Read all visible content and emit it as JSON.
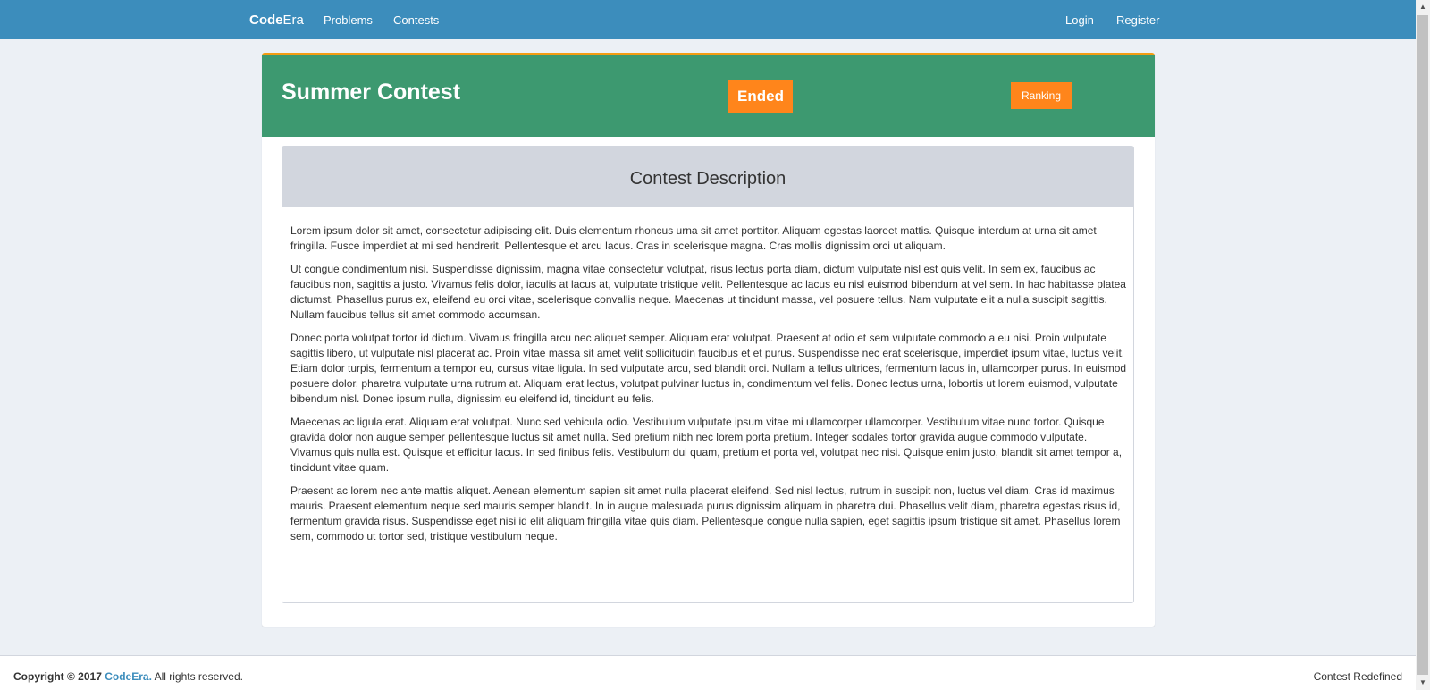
{
  "navbar": {
    "brand_bold": "Code",
    "brand_rest": "Era",
    "links": [
      "Problems",
      "Contests"
    ],
    "login_label": "Login",
    "register_label": "Register"
  },
  "contest": {
    "title": "Summer Contest",
    "status": "Ended",
    "ranking_label": "Ranking"
  },
  "description": {
    "heading": "Contest Description",
    "paragraphs": [
      "Lorem ipsum dolor sit amet, consectetur adipiscing elit. Duis elementum rhoncus urna sit amet porttitor. Aliquam egestas laoreet mattis. Quisque interdum at urna sit amet fringilla. Fusce imperdiet at mi sed hendrerit. Pellentesque et arcu lacus. Cras in scelerisque magna. Cras mollis dignissim orci ut aliquam.",
      "Ut congue condimentum nisi. Suspendisse dignissim, magna vitae consectetur volutpat, risus lectus porta diam, dictum vulputate nisl est quis velit. In sem ex, faucibus ac faucibus non, sagittis a justo. Vivamus felis dolor, iaculis at lacus at, vulputate tristique velit. Pellentesque ac lacus eu nisl euismod bibendum at vel sem. In hac habitasse platea dictumst. Phasellus purus ex, eleifend eu orci vitae, scelerisque convallis neque. Maecenas ut tincidunt massa, vel posuere tellus. Nam vulputate elit a nulla suscipit sagittis. Nullam faucibus tellus sit amet commodo accumsan.",
      "Donec porta volutpat tortor id dictum. Vivamus fringilla arcu nec aliquet semper. Aliquam erat volutpat. Praesent at odio et sem vulputate commodo a eu nisi. Proin vulputate sagittis libero, ut vulputate nisl placerat ac. Proin vitae massa sit amet velit sollicitudin faucibus et et purus. Suspendisse nec erat scelerisque, imperdiet ipsum vitae, luctus velit. Etiam dolor turpis, fermentum a tempor eu, cursus vitae ligula. In sed vulputate arcu, sed blandit orci. Nullam a tellus ultrices, fermentum lacus in, ullamcorper purus. In euismod posuere dolor, pharetra vulputate urna rutrum at. Aliquam erat lectus, volutpat pulvinar luctus in, condimentum vel felis. Donec lectus urna, lobortis ut lorem euismod, vulputate bibendum nisl. Donec ipsum nulla, dignissim eu eleifend id, tincidunt eu felis.",
      "Maecenas ac ligula erat. Aliquam erat volutpat. Nunc sed vehicula odio. Vestibulum vulputate ipsum vitae mi ullamcorper ullamcorper. Vestibulum vitae nunc tortor. Quisque gravida dolor non augue semper pellentesque luctus sit amet nulla. Sed pretium nibh nec lorem porta pretium. Integer sodales tortor gravida augue commodo vulputate. Vivamus quis nulla est. Quisque et efficitur lacus. In sed finibus felis. Vestibulum dui quam, pretium et porta vel, volutpat nec nisi. Quisque enim justo, blandit sit amet tempor a, tincidunt vitae quam.",
      "Praesent ac lorem nec ante mattis aliquet. Aenean elementum sapien sit amet nulla placerat eleifend. Sed nisl lectus, rutrum in suscipit non, luctus vel diam. Cras id maximus mauris. Praesent elementum neque sed mauris semper blandit. In in augue malesuada purus dignissim aliquam in pharetra dui. Phasellus velit diam, pharetra egestas risus id, fermentum gravida risus. Suspendisse eget nisi id elit aliquam fringilla vitae quis diam. Pellentesque congue nulla sapien, eget sagittis ipsum tristique sit amet. Phasellus lorem sem, commodo ut tortor sed, tristique vestibulum neque."
    ]
  },
  "footer": {
    "copyright_prefix": "Copyright © 2017",
    "copyright_link": "CodeEra.",
    "copyright_suffix": "All rights reserved.",
    "tagline": "Contest Redefined"
  },
  "colors": {
    "navbar": "#3c8dbc",
    "contest_header": "#3d9970",
    "accent_orange": "#ff851b",
    "top_border": "#f39c12",
    "desc_header": "#d2d6de",
    "page_bg": "#ecf0f5"
  },
  "icons": {
    "scroll_up": "triangle-up-icon",
    "scroll_down": "triangle-down-icon"
  }
}
